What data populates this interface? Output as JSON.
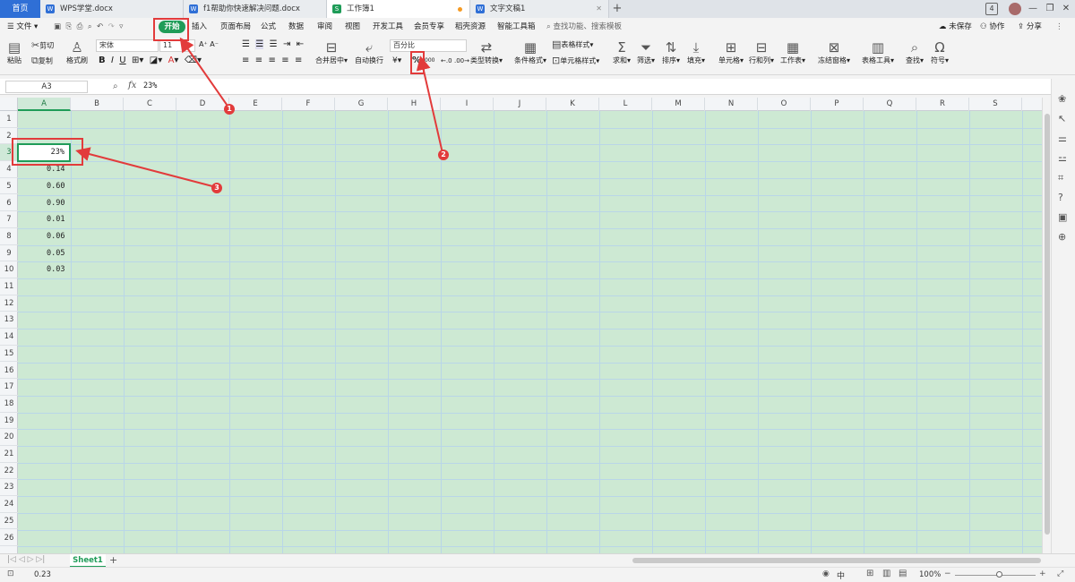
{
  "tabs": {
    "home": "首页",
    "docs": [
      {
        "label": "WPS学堂.docx",
        "icon": "W"
      },
      {
        "label": "f1帮助你快速解决问题.docx",
        "icon": "W"
      },
      {
        "label": "工作簿1",
        "icon": "S"
      },
      {
        "label": "文字文稿1",
        "icon": "W"
      }
    ],
    "add": "+",
    "badge": "4"
  },
  "menu": {
    "file": "文件",
    "items": [
      "开始",
      "插入",
      "页面布局",
      "公式",
      "数据",
      "审阅",
      "视图",
      "开发工具",
      "会员专享",
      "稻壳资源",
      "智能工具箱"
    ],
    "search_placeholder": "查找功能、搜索模板",
    "unsaved": "未保存",
    "collab": "协作",
    "share": "分享"
  },
  "ribbon": {
    "paste": "粘贴",
    "cut": "剪切",
    "copy": "复制",
    "format_painter": "格式刷",
    "font_name": "宋体",
    "font_size": "11",
    "merge_center": "合并居中",
    "wrap_text": "自动换行",
    "number_format": "百分比",
    "currency": "¥",
    "percent": "%",
    "thousands": "000",
    "type_convert": "类型转换",
    "cond_format": "条件格式",
    "table_style": "表格样式",
    "cell_style": "单元格样式",
    "sum": "求和",
    "filter": "筛选",
    "sort": "排序",
    "fill": "填充",
    "cell": "单元格",
    "row_col": "行和列",
    "worksheet": "工作表",
    "freeze": "冻结窗格",
    "table_tools": "表格工具",
    "find": "查找",
    "symbol": "符号"
  },
  "formula": {
    "name_box": "A3",
    "fx": "fx",
    "content": "23%"
  },
  "grid": {
    "columns": [
      "A",
      "B",
      "C",
      "D",
      "E",
      "F",
      "G",
      "H",
      "I",
      "J",
      "K",
      "L",
      "M",
      "N",
      "O",
      "P",
      "Q",
      "R",
      "S"
    ],
    "rows": [
      "1",
      "2",
      "3",
      "4",
      "5",
      "6",
      "7",
      "8",
      "9",
      "10",
      "11",
      "12",
      "13",
      "14",
      "15",
      "16",
      "17",
      "18",
      "19",
      "20",
      "21",
      "22",
      "23",
      "24",
      "25",
      "26"
    ],
    "cells": {
      "A3": "23%",
      "A4": "0.14",
      "A5": "0.60",
      "A6": "0.90",
      "A7": "0.01",
      "A8": "0.06",
      "A9": "0.05",
      "A10": "0.03"
    }
  },
  "sheet": {
    "name": "Sheet1",
    "add": "+"
  },
  "status": {
    "value": "0.23",
    "zoom": "100%",
    "ime": "中"
  },
  "annotations": [
    "1",
    "2",
    "3"
  ],
  "colors": {
    "accent": "#1f9c58",
    "grid_bg": "#cde9d3",
    "annotation": "#e23b3b"
  }
}
